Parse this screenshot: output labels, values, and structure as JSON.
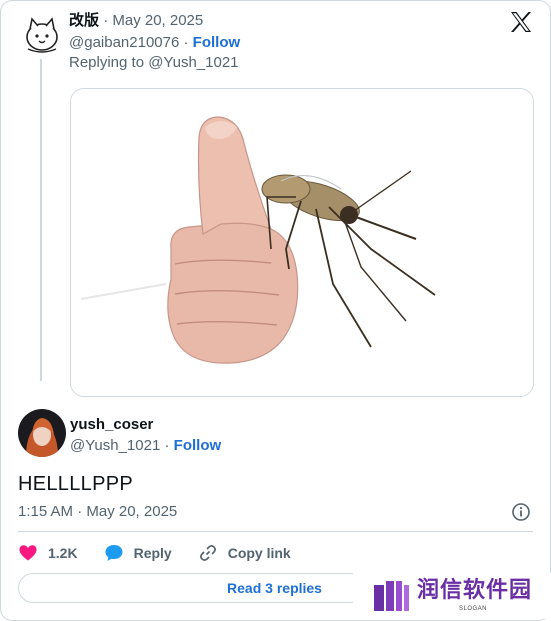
{
  "parent_tweet": {
    "author_name": "改版",
    "date": "· May 20, 2025",
    "handle": "@gaiban210076",
    "separator": "·",
    "follow_label": "Follow",
    "replying_to": "Replying to @Yush_1021",
    "media_alt": "hand giving thumbs up to a mosquito"
  },
  "tweet": {
    "author_name": "yush_coser",
    "handle": "@Yush_1021",
    "separator": "·",
    "follow_label": "Follow",
    "text": "HELLLLPPP",
    "timestamp": "1:15 AM · May 20, 2025"
  },
  "actions": {
    "likes": "1.2K",
    "reply_label": "Reply",
    "copy_link_label": "Copy link"
  },
  "read_replies_label": "Read 3 replies",
  "watermark": {
    "text": "润信软件园",
    "slogan": "SLOGAN"
  },
  "icons": {
    "platform": "x-logo-icon",
    "like": "heart-icon",
    "reply": "speech-bubble-icon",
    "copy_link": "link-icon",
    "info": "info-icon"
  },
  "colors": {
    "link": "#1d6fd6",
    "like": "#f91880",
    "reply": "#1d9bf0",
    "muted": "#536471",
    "border": "#cfd9de"
  }
}
